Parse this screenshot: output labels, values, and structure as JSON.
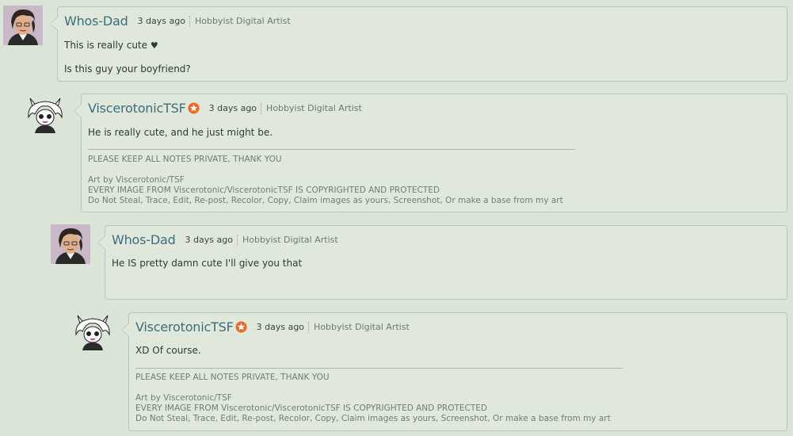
{
  "comments": [
    {
      "username": "Whos-Dad",
      "time": "3 days ago",
      "role": "Hobbyist Digital Artist",
      "lines": [
        "This is really cute",
        "Is this guy your boyfriend?"
      ],
      "heart": "♥"
    },
    {
      "username": "ViscerotonicTSF",
      "time": "3 days ago",
      "role": "Hobbyist Digital Artist",
      "lines": [
        "He is really cute, and he just might be."
      ],
      "signature": {
        "notice": "PLEASE KEEP ALL NOTES PRIVATE, THANK YOU",
        "credit": "Art by Viscerotonic/TSF",
        "copyright": "EVERY IMAGE FROM Viscerotonic/ViscerotonicTSF IS COPYRIGHTED AND PROTECTED",
        "rules": "Do Not Steal, Trace, Edit, Re-post, Recolor, Copy, Claim images as yours, Screenshot, Or make a base from my art"
      }
    },
    {
      "username": "Whos-Dad",
      "time": "3 days ago",
      "role": "Hobbyist Digital Artist",
      "lines": [
        "He IS pretty damn cute I'll give you that"
      ]
    },
    {
      "username": "ViscerotonicTSF",
      "time": "3 days ago",
      "role": "Hobbyist Digital Artist",
      "lines": [
        "XD Of course."
      ],
      "signature": {
        "notice": "PLEASE KEEP ALL NOTES PRIVATE, THANK YOU",
        "credit": "Art by Viscerotonic/TSF",
        "copyright": "EVERY IMAGE FROM Viscerotonic/ViscerotonicTSF IS COPYRIGHTED AND PROTECTED",
        "rules": "Do Not Steal, Trace, Edit, Re-post, Recolor, Copy, Claim images as yours, Screenshot, Or make a base from my art"
      }
    }
  ],
  "colors": {
    "background": "#dae4d7",
    "username": "#3d6d7c",
    "badge": "#e8692a"
  }
}
